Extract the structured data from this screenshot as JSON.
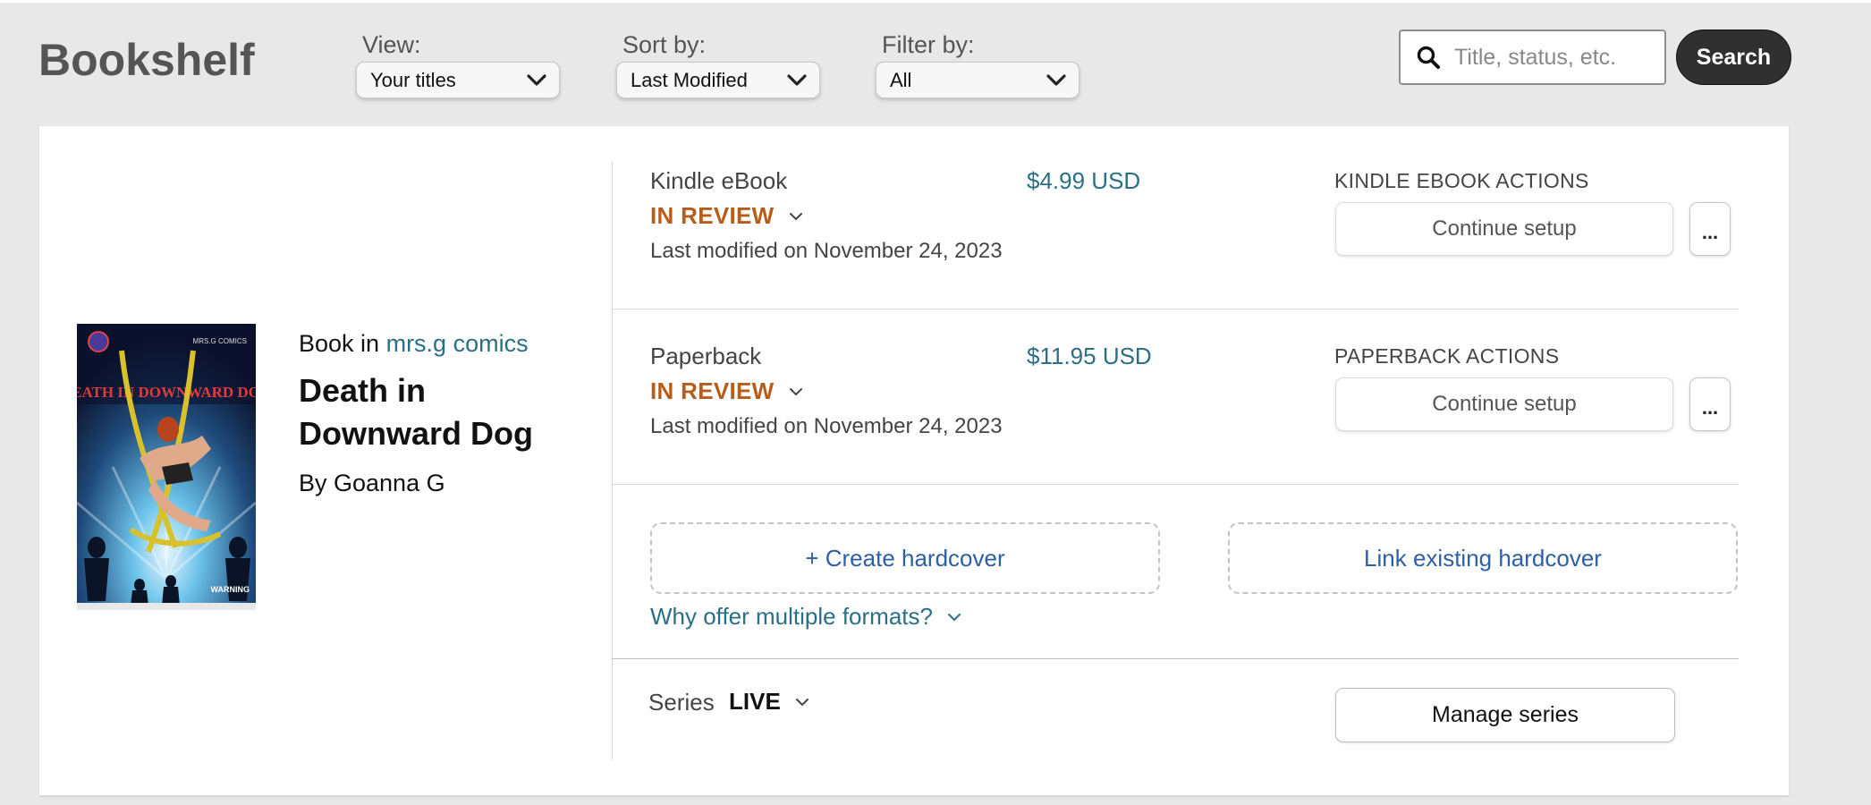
{
  "header": {
    "title": "Bookshelf",
    "view": {
      "label": "View:",
      "selected": "Your titles"
    },
    "sort": {
      "label": "Sort by:",
      "selected": "Last Modified"
    },
    "filter": {
      "label": "Filter by:",
      "selected": "All"
    },
    "search": {
      "placeholder": "Title, status, etc.",
      "button_label": "Search"
    }
  },
  "book": {
    "book_in_prefix": "Book in",
    "series_link": "mrs.g comics",
    "title": "Death in Downward Dog",
    "author": "By Goanna G",
    "cover": {
      "title_text": "DEATH IN DOWNWARD DOG",
      "top_right_text": "MRS.G COMICS",
      "bottom_right_text": "WARNING"
    }
  },
  "formats": [
    {
      "name": "Kindle eBook",
      "price": "$4.99 USD",
      "status": "IN REVIEW",
      "modified": "Last modified on November 24, 2023",
      "actions_label": "KINDLE EBOOK ACTIONS",
      "action_button": "Continue setup",
      "more_label": "..."
    },
    {
      "name": "Paperback",
      "price": "$11.95 USD",
      "status": "IN REVIEW",
      "modified": "Last modified on November 24, 2023",
      "actions_label": "PAPERBACK ACTIONS",
      "action_button": "Continue setup",
      "more_label": "..."
    }
  ],
  "hardcover": {
    "create_label": "+ Create hardcover",
    "link_label": "Link existing hardcover",
    "why_label": "Why offer multiple formats?"
  },
  "series": {
    "label": "Series",
    "status": "LIVE",
    "manage_label": "Manage series"
  },
  "colors": {
    "status_review": "#b75d1c",
    "link": "#2a6f86",
    "action_link": "#2d5fa5",
    "search_button": "#303030"
  }
}
